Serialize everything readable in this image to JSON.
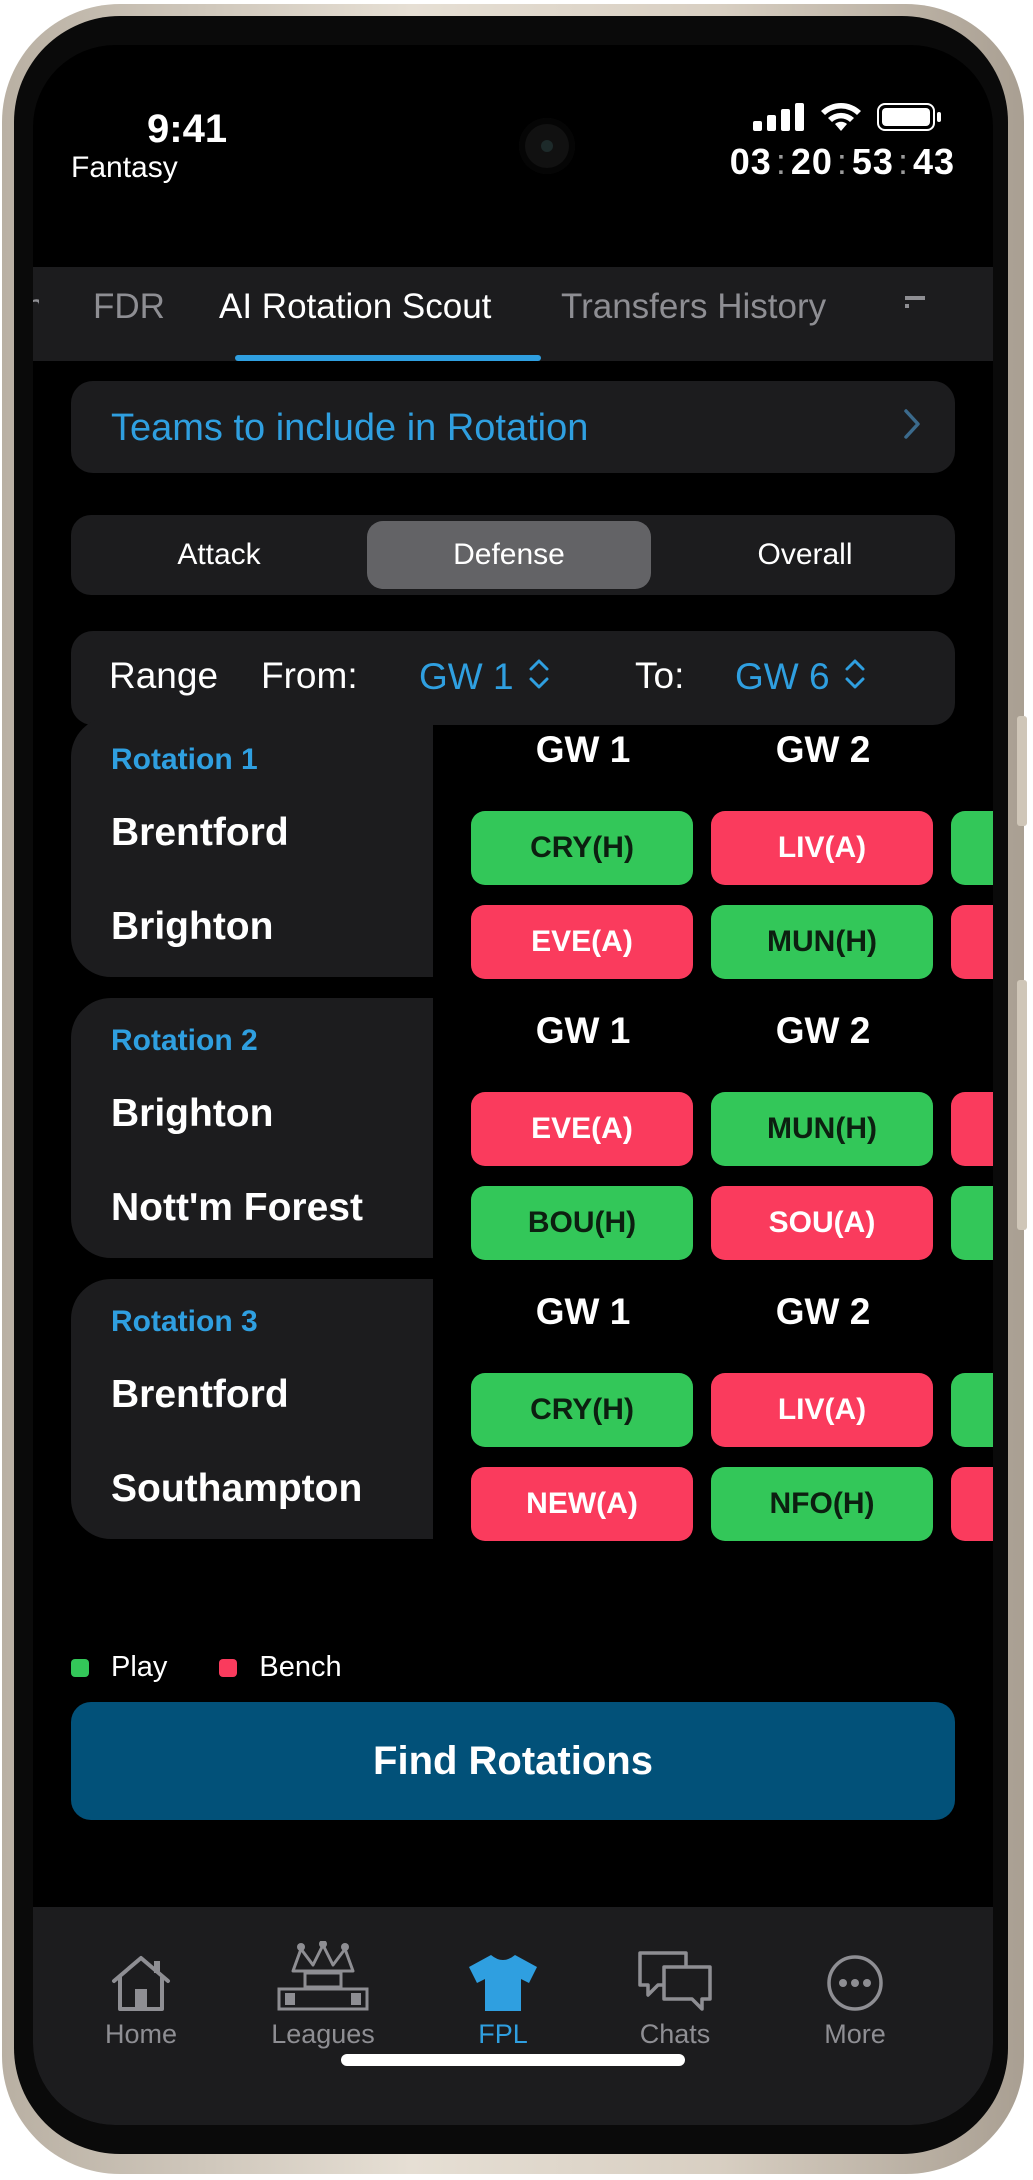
{
  "status_bar": {
    "time": "9:41",
    "subtitle": "Fantasy",
    "deadline": [
      "03",
      "20",
      "53",
      "43"
    ]
  },
  "tabs": [
    "FDR",
    "AI Rotation Scout",
    "Transfers History"
  ],
  "active_tab": "AI Rotation Scout",
  "teams_row": {
    "label": "Teams to include in Rotation"
  },
  "segments": [
    "Attack",
    "Defense",
    "Overall"
  ],
  "active_segment": "Defense",
  "range": {
    "label": "Range",
    "from_label": "From:",
    "from_value": "GW 1",
    "to_label": "To:",
    "to_value": "GW 6"
  },
  "rotations": [
    {
      "title": "Rotation 1",
      "teams": [
        "Brentford",
        "Brighton"
      ],
      "gw_headers": [
        "GW 1",
        "GW 2"
      ],
      "fixtures": [
        [
          {
            "text": "CRY(H)",
            "status": "play"
          },
          {
            "text": "LIV(A)",
            "status": "bench"
          }
        ],
        [
          {
            "text": "EVE(A)",
            "status": "bench"
          },
          {
            "text": "MUN(H)",
            "status": "play"
          }
        ]
      ]
    },
    {
      "title": "Rotation 2",
      "teams": [
        "Brighton",
        "Nott'm Forest"
      ],
      "gw_headers": [
        "GW 1",
        "GW 2"
      ],
      "fixtures": [
        [
          {
            "text": "EVE(A)",
            "status": "bench"
          },
          {
            "text": "MUN(H)",
            "status": "play"
          }
        ],
        [
          {
            "text": "BOU(H)",
            "status": "play"
          },
          {
            "text": "SOU(A)",
            "status": "bench"
          }
        ]
      ]
    },
    {
      "title": "Rotation 3",
      "teams": [
        "Brentford",
        "Southampton"
      ],
      "gw_headers": [
        "GW 1",
        "GW 2"
      ],
      "fixtures": [
        [
          {
            "text": "CRY(H)",
            "status": "play"
          },
          {
            "text": "LIV(A)",
            "status": "bench"
          }
        ],
        [
          {
            "text": "NEW(A)",
            "status": "bench"
          },
          {
            "text": "NFO(H)",
            "status": "play"
          }
        ]
      ]
    }
  ],
  "partial_third_column": [
    [
      "play",
      "bench"
    ],
    [
      "bench",
      "play"
    ],
    [
      "play",
      "bench"
    ]
  ],
  "legend": {
    "play": "Play",
    "bench": "Bench"
  },
  "find_button": "Find Rotations",
  "bottom_nav": [
    {
      "label": "Home",
      "icon": "home-icon"
    },
    {
      "label": "Leagues",
      "icon": "crown-icon"
    },
    {
      "label": "FPL",
      "icon": "shirt-icon"
    },
    {
      "label": "Chats",
      "icon": "chat-bubbles-icon"
    },
    {
      "label": "More",
      "icon": "more-icon"
    }
  ],
  "active_nav": "FPL",
  "colors": {
    "accent": "#2f9fe0",
    "play": "#33c759",
    "bench": "#fa3b5d",
    "button": "#025179"
  }
}
